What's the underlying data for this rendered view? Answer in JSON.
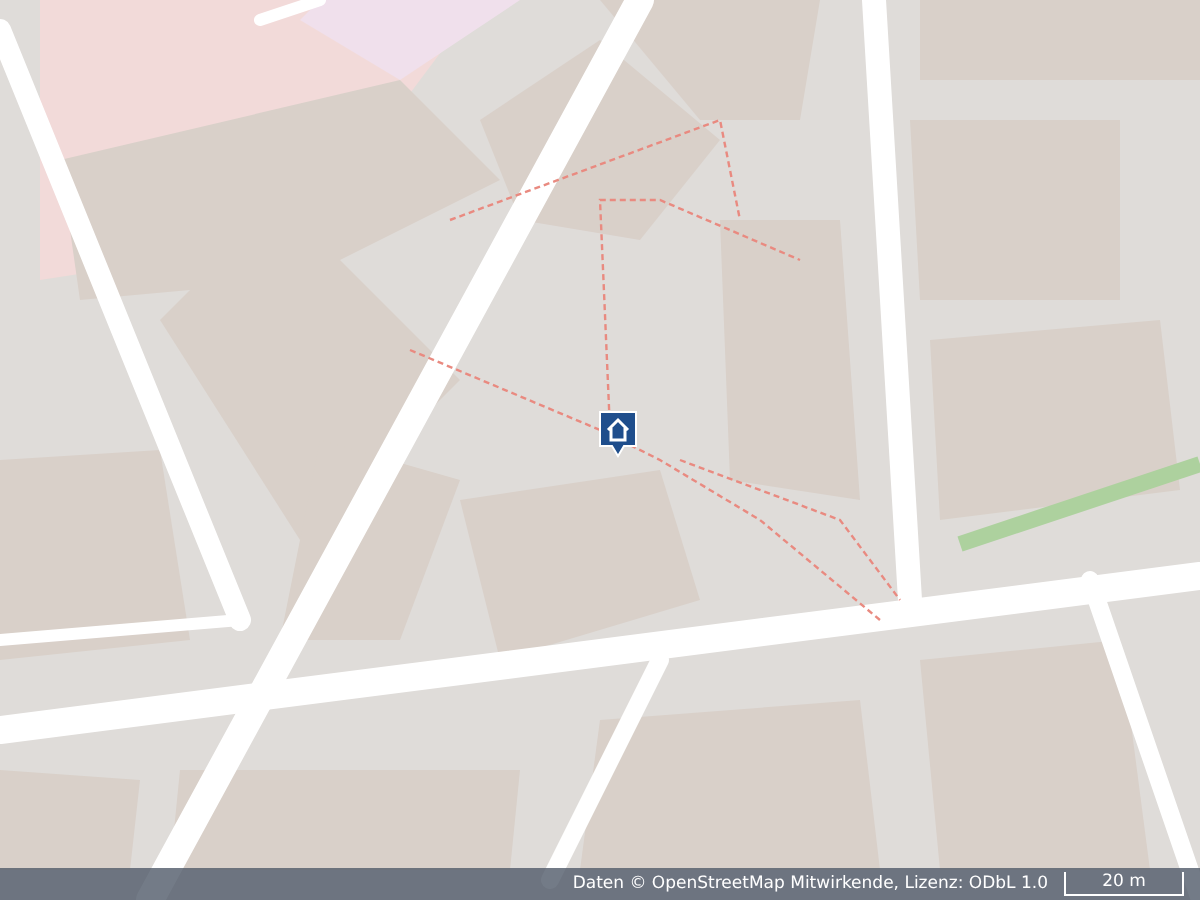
{
  "attribution": {
    "text": "Daten © OpenStreetMap Mitwirkende, Lizenz: ODbL 1.0"
  },
  "scale": {
    "label": "20 m"
  }
}
